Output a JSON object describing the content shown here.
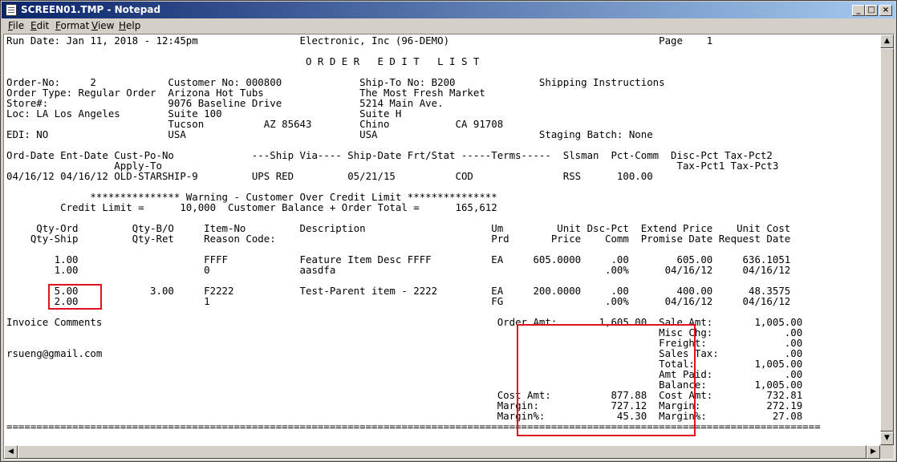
{
  "window": {
    "title": "SCREEN01.TMP - Notepad",
    "buttons": {
      "minimize": "_",
      "maximize": "□",
      "close": "×"
    }
  },
  "menu": {
    "file": {
      "ul": "F",
      "rest": "ile"
    },
    "edit": {
      "ul": "E",
      "rest": "dit"
    },
    "format": {
      "ul": "F",
      "rest": "ormat"
    },
    "format_pre": "",
    "view": {
      "ul": "V",
      "rest": "iew"
    },
    "help": {
      "ul": "H",
      "rest": "elp"
    }
  },
  "document": {
    "lines": [
      "Run Date: Jan 11, 2018 - 12:45pm                 Electronic, Inc (96-DEMO)                                   Page    1",
      "",
      "                                                  O R D E R   E D I T   L I S T",
      "",
      "Order-No:     2            Customer No: 000800             Ship-To No: B200              Shipping Instructions",
      "Order Type: Regular Order  Arizona Hot Tubs                The Most Fresh Market",
      "Store#:                    9076 Baseline Drive             5214 Main Ave.",
      "Loc: LA Los Angeles        Suite 100                       Suite H",
      "                           Tucson          AZ 85643        Chino           CA 91708",
      "EDI: NO                    USA                             USA                           Staging Batch: None",
      "",
      "Ord-Date Ent-Date Cust-Po-No             ---Ship Via---- Ship-Date Frt/Stat -----Terms-----  Slsman  Pct-Comm  Disc-Pct Tax-Pct2",
      "                  Apply-To                                                                                      Tax-Pct1 Tax-Pct3",
      "04/16/12 04/16/12 OLD-STARSHIP-9         UPS RED         05/21/15          COD               RSS      100.00",
      "",
      "              *************** Warning - Customer Over Credit Limit ***************",
      "         Credit Limit =      10,000  Customer Balance + Order Total =      165,612",
      "",
      "     Qty-Ord         Qty-B/O     Item-No         Description                     Um         Unit Dsc-Pct  Extend Price    Unit Cost",
      "    Qty-Ship         Qty-Ret     Reason Code:                                    Prd       Price    Comm  Promise Date Request Date",
      "",
      "        1.00                     FFFF            Feature Item Desc FFFF          EA     605.0000     .00        605.00     636.1051",
      "        1.00                     0               aasdfa                                             .00%      04/16/12     04/16/12",
      "",
      "        5.00            3.00     F2222           Test-Parent item - 2222         EA     200.0000     .00        400.00      48.3575",
      "        2.00                     1                                               FG                 .00%      04/16/12     04/16/12",
      "",
      "Invoice Comments                                                                  Order Amt:       1,605.00  Sale Amt:       1,005.00",
      "                                                                                                             Misc Chg:            .00",
      "                                                                                                             Freight:             .00",
      "rsueng@gmail.com                                                                                             Sales Tax:           .00",
      "                                                                                                             Total:          1,005.00",
      "                                                                                                             Amt Paid:            .00",
      "                                                                                                             Balance:        1,005.00",
      "                                                                                  Cost Amt:          877.88  Cost Amt:         732.81",
      "                                                                                  Margin:            727.12  Margin:           272.19",
      "                                                                                  Margin%:            45.30  Margin%:           27.08",
      "========================================================================================================================================"
    ]
  },
  "colors": {
    "title_bar": "#0a246a",
    "highlight_box": "#e0131c",
    "chrome": "#d4d0c8"
  },
  "icons": [
    "notepad-icon",
    "minimize-icon",
    "maximize-icon",
    "close-icon",
    "scroll-up-icon",
    "scroll-down-icon",
    "scroll-left-icon",
    "scroll-right-icon"
  ]
}
